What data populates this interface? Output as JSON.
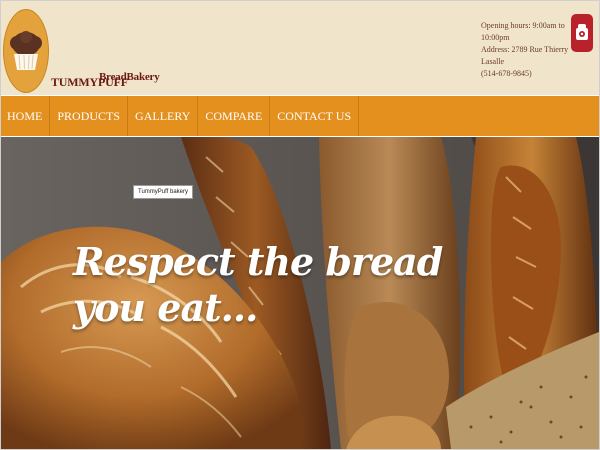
{
  "header": {
    "brand_main": "TUMMYPUFF",
    "brand_sub": "BreadBakery",
    "contact_lines": [
      "Opening hours: 9:00am to 10:00pm",
      "Address: 2789 Rue Thierry Lasalle",
      "(514-678-9845)"
    ]
  },
  "nav": {
    "items": [
      "HOME",
      "PRODUCTS",
      "GALLERY",
      "COMPARE",
      "CONTACT US"
    ]
  },
  "hero": {
    "tag": "TummyPuff bakery",
    "title_lines": [
      "Respect the bread",
      "you eat..."
    ]
  },
  "colors": {
    "header_bg": "#f0e4cb",
    "nav_bg": "#e3901e",
    "brand": "#6b1a12",
    "phone_bg": "#b8222a"
  },
  "icons": {
    "logo": "muffin-logo-icon",
    "phone": "phone-icon"
  }
}
